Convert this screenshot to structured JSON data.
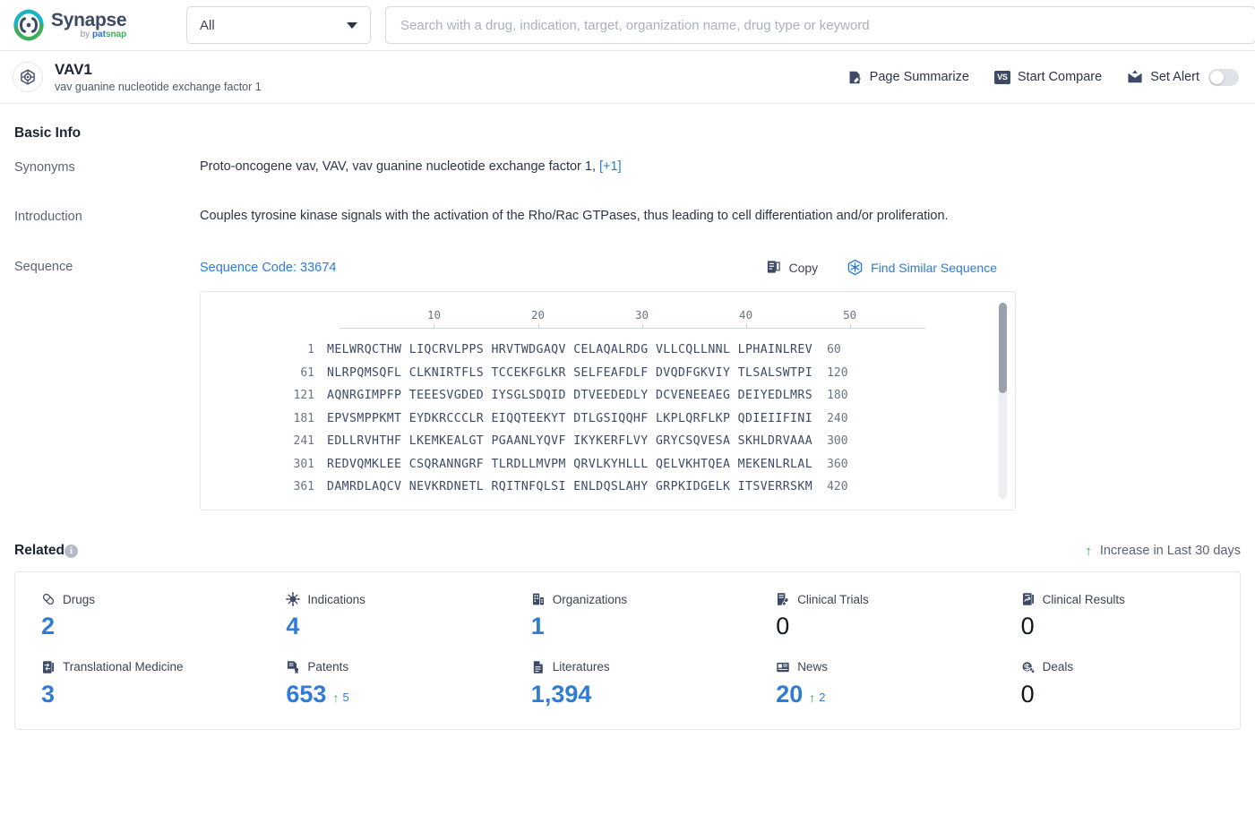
{
  "topbar": {
    "logo": {
      "name": "Synapse",
      "by": "by ",
      "pat": "pat",
      "snap": "snap",
      "icon": "synapse-logo-icon"
    },
    "scope_select": {
      "value": "All",
      "icon": "chevron-down-icon"
    },
    "search": {
      "value": "",
      "placeholder": "Search with a drug, indication, target, organization name, drug type or keyword",
      "icon": "search-input"
    }
  },
  "entity": {
    "avatar_icon": "target-gene-icon",
    "name": "VAV1",
    "description": "vav guanine nucleotide exchange factor 1",
    "actions": {
      "page_summarize": "Page Summarize",
      "page_summarize_icon": "document-edit-icon",
      "start_compare": "Start Compare",
      "start_compare_icon": "vs-badge-icon",
      "set_alert": "Set Alert",
      "set_alert_icon": "mail-alert-icon",
      "alert_toggle_state": "off"
    }
  },
  "basic_info": {
    "title": "Basic Info",
    "synonyms": {
      "label": "Synonyms",
      "value": "Proto-oncogene vav,  VAV,  vav guanine nucleotide exchange factor 1,",
      "more": "[+1]"
    },
    "introduction": {
      "label": "Introduction",
      "value": "Couples tyrosine kinase signals with the activation of the Rho/Rac GTPases, thus leading to cell differentiation and/or proliferation."
    },
    "sequence": {
      "label": "Sequence",
      "code_label": "Sequence Code: 33674",
      "copy_label": "Copy",
      "copy_icon": "copy-icon",
      "similar_label": "Find Similar Sequence",
      "similar_icon": "find-similar-sequence-icon",
      "ruler_ticks": [
        10,
        20,
        30,
        40,
        50
      ],
      "rows": [
        {
          "start": "1",
          "chunks": "MELWRQCTHW LIQCRVLPPS HRVTWDGAQV CELAQALRDG VLLCQLLNNL LPHAINLREV",
          "end": "60"
        },
        {
          "start": "61",
          "chunks": "NLRPQMSQFL CLKNIRTFLS TCCEKFGLKR SELFEAFDLF DVQDFGKVIY TLSALSWTPI",
          "end": "120"
        },
        {
          "start": "121",
          "chunks": "AQNRGIMPFP TEEESVGDED IYSGLSDQID DTVEEDEDLY DCVENEEAEG DEIYEDLMRS",
          "end": "180"
        },
        {
          "start": "181",
          "chunks": "EPVSMPPKMT EYDKRCCCLR EIQQTEEKYT DTLGSIQQHF LKPLQRFLKP QDIEIIFINI",
          "end": "240"
        },
        {
          "start": "241",
          "chunks": "EDLLRVHTHF LKEMKEALGT PGAANLYQVF IKYKERFLVY GRYCSQVESA SKHLDRVAAA",
          "end": "300"
        },
        {
          "start": "301",
          "chunks": "REDVQMKLEE CSQRANNGRF TLRDLLMVPM QRVLKYHLLL QELVKHTQEA MEKENLRLAL",
          "end": "360"
        },
        {
          "start": "361",
          "chunks": "DAMRDLAQCV NEVKRDNETL RQITNFQLSI ENLDQSLAHY GRPKIDGELK ITSVERRSKM",
          "end": "420"
        }
      ]
    }
  },
  "related": {
    "title": "Related",
    "info_icon": "info-icon",
    "info_glyph": "i",
    "increase_note": "Increase in Last 30 days",
    "increase_icon": "arrow-up-icon",
    "stats": [
      {
        "label": "Drugs",
        "icon": "capsule-icon",
        "value": "2",
        "delta": null,
        "zero": false
      },
      {
        "label": "Indications",
        "icon": "virus-icon",
        "value": "4",
        "delta": null,
        "zero": false
      },
      {
        "label": "Organizations",
        "icon": "building-icon",
        "value": "1",
        "delta": null,
        "zero": false
      },
      {
        "label": "Clinical Trials",
        "icon": "clinical-trial-icon",
        "value": "0",
        "delta": null,
        "zero": true
      },
      {
        "label": "Clinical Results",
        "icon": "clinical-results-icon",
        "value": "0",
        "delta": null,
        "zero": true
      },
      {
        "label": "Translational Medicine",
        "icon": "translational-medicine-icon",
        "value": "3",
        "delta": null,
        "zero": false
      },
      {
        "label": "Patents",
        "icon": "patent-icon",
        "value": "653",
        "delta": "5",
        "zero": false
      },
      {
        "label": "Literatures",
        "icon": "literature-icon",
        "value": "1,394",
        "delta": null,
        "zero": false
      },
      {
        "label": "News",
        "icon": "news-icon",
        "value": "20",
        "delta": "2",
        "zero": false
      },
      {
        "label": "Deals",
        "icon": "deals-icon",
        "value": "0",
        "delta": null,
        "zero": true
      }
    ]
  },
  "colors": {
    "accent_blue": "#2f7bd6",
    "dark_navy": "#3d4a66",
    "green": "#2aa44f",
    "border": "#e5e7eb"
  }
}
